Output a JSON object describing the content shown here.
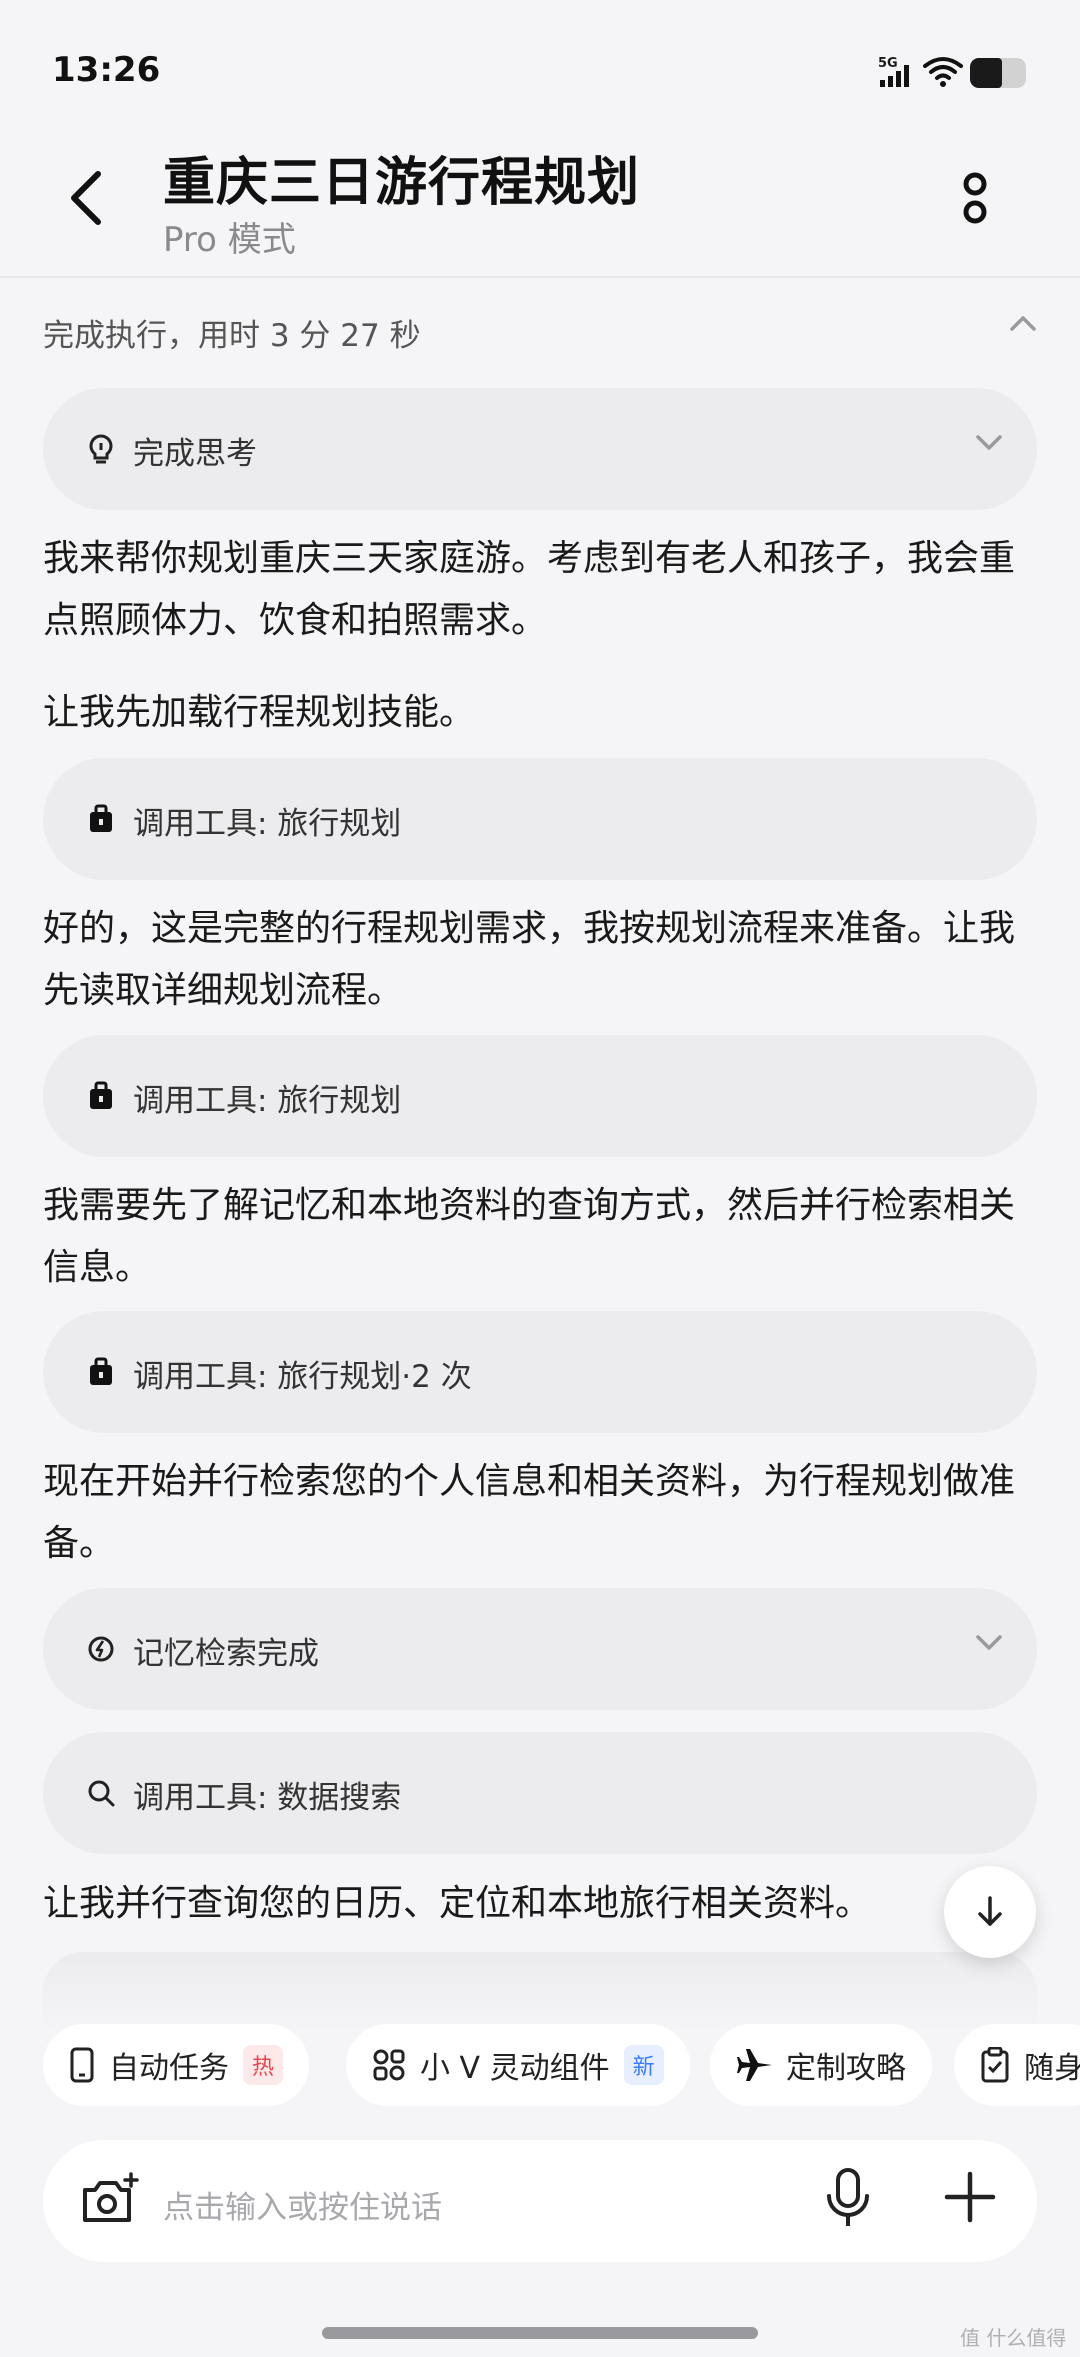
{
  "status_bar": {
    "time": "13:26",
    "network": "5G"
  },
  "header": {
    "title": "重庆三日游行程规划",
    "subtitle": "Pro 模式"
  },
  "exec_summary": "完成执行，用时 3 分 27 秒",
  "blocks": {
    "thinking": "完成思考",
    "p1": "我来帮你规划重庆三天家庭游。考虑到有老人和孩子，我会重点照顾体力、饮食和拍照需求。",
    "p2": "让我先加载行程规划技能。",
    "tool1": "调用工具: 旅行规划",
    "p3": "好的，这是完整的行程规划需求，我按规划流程来准备。让我先读取详细规划流程。",
    "tool2": "调用工具: 旅行规划",
    "p4": "我需要先了解记忆和本地资料的查询方式，然后并行检索相关信息。",
    "tool3": "调用工具: 旅行规划·2 次",
    "p5": "现在开始并行检索您的个人信息和相关资料，为行程规划做准备。",
    "memory": "记忆检索完成",
    "search": "调用工具: 数据搜索",
    "p6": "让我并行查询您的日历、定位和本地旅行相关资料。"
  },
  "chips": [
    {
      "label": "自动任务",
      "badge": "热",
      "icon": "phone-icon"
    },
    {
      "label": "小 V 灵动组件",
      "badge": "新",
      "icon": "widgets-icon"
    },
    {
      "label": "定制攻略",
      "icon": "plane-icon"
    },
    {
      "label": "随身",
      "icon": "clipboard-icon"
    }
  ],
  "input": {
    "placeholder": "点击输入或按住说话"
  },
  "watermark": "值 什么值得买",
  "colors": {
    "background": "#f5f5f7",
    "card": "#ececef",
    "hot": "#e5484d",
    "new": "#3a7bff"
  }
}
